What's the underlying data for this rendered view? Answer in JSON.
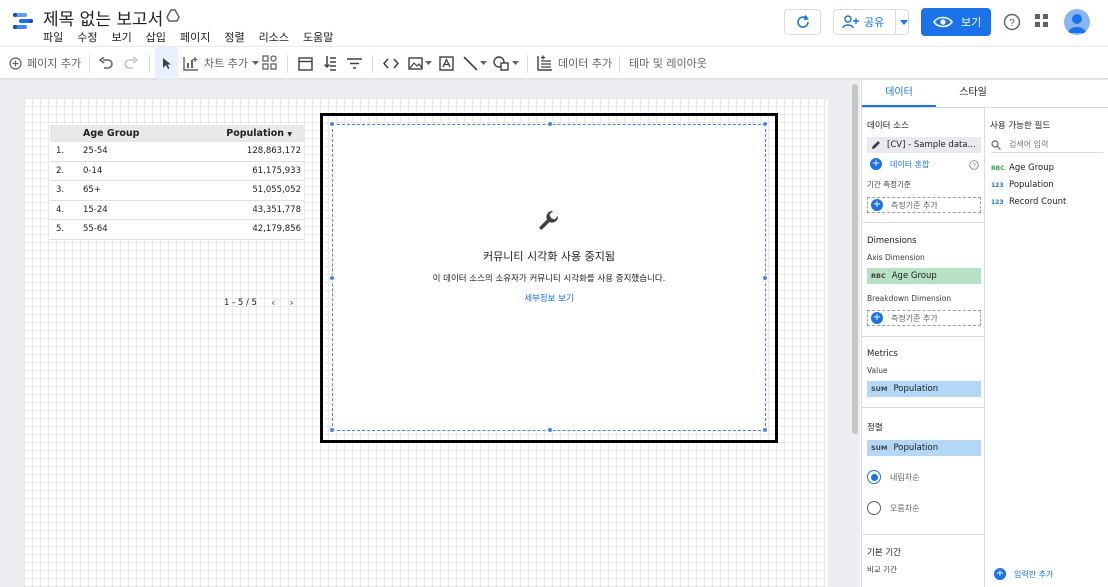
{
  "app": {
    "title": "제목 없는 보고서",
    "menu": [
      "파일",
      "수정",
      "보기",
      "삽입",
      "페이지",
      "정렬",
      "리소스",
      "도움말"
    ],
    "share_label": "공유",
    "view_label": "보기"
  },
  "toolbar": {
    "add_page": "페이지 추가",
    "add_chart": "차트 추가",
    "add_data": "데이터 추가",
    "theme_layout": "테마 및 레이아웃"
  },
  "table": {
    "headers": [
      "Age Group",
      "Population"
    ],
    "rows": [
      {
        "n": "1.",
        "age": "25-54",
        "pop": "128,863,172"
      },
      {
        "n": "2.",
        "age": "0-14",
        "pop": "61,175,933"
      },
      {
        "n": "3.",
        "age": "65+",
        "pop": "51,055,052"
      },
      {
        "n": "4.",
        "age": "15-24",
        "pop": "43,351,778"
      },
      {
        "n": "5.",
        "age": "55-64",
        "pop": "42,179,856"
      }
    ],
    "pager": "1 - 5 / 5"
  },
  "community_viz": {
    "title": "커뮤니티 시각화 사용 중지됨",
    "desc": "이 데이터 소스의 소유자가 커뮤니티 시각화를 사용 중지했습니다.",
    "link": "세부정보 보기"
  },
  "panel": {
    "tabs": [
      "데이터",
      "스타일"
    ],
    "data_source_title": "데이터 소스",
    "data_source": "[CV] - Sample data...",
    "blend": "데이터 혼합",
    "date_range_title": "기간 측정기준",
    "add_dimension": "측정기준 추가",
    "dimensions_title": "Dimensions",
    "axis_dimension_title": "Axis Dimension",
    "axis_dimension": "Age Group",
    "breakdown_title": "Breakdown Dimension",
    "add_breakdown": "측정기준 추가",
    "metrics_title": "Metrics",
    "value_title": "Value",
    "metric": "Population",
    "sort_title": "정렬",
    "sort_metric": "Population",
    "sort_desc": "내림차순",
    "sort_asc": "오름차순",
    "default_range_title": "기본 기간",
    "compare_title": "비교 기간",
    "available_fields_title": "사용 가능한 필드",
    "search_placeholder": "검색어 입력",
    "fields": [
      {
        "type": "RBC",
        "name": "Age Group"
      },
      {
        "type": "123",
        "name": "Population"
      },
      {
        "type": "123",
        "name": "Record Count"
      }
    ],
    "add_field": "입력란 추가",
    "sum_tag": "SUM",
    "rbc_tag": "RBC"
  },
  "colors": {
    "accent": "#1a73e8",
    "dimension": "#b7e1c4",
    "metric": "#b4d7f5"
  }
}
